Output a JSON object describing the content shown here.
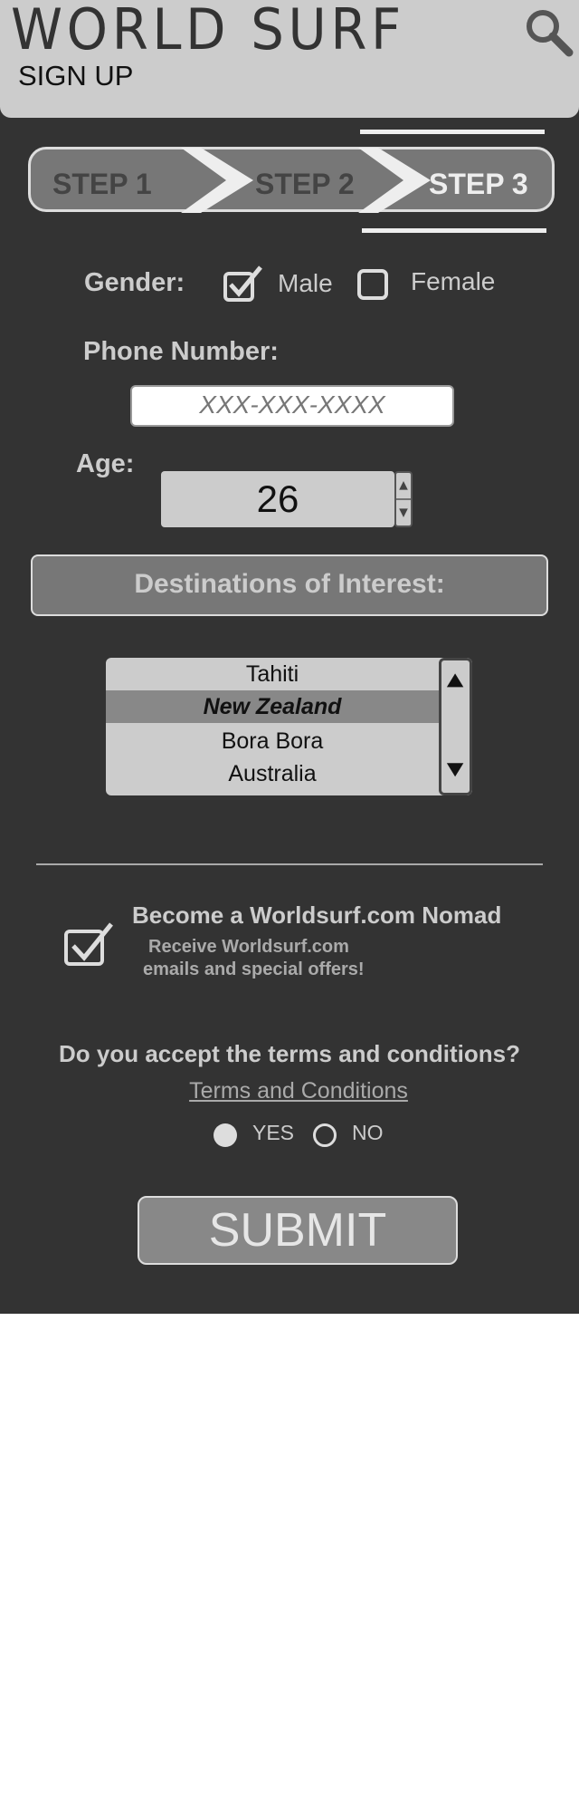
{
  "header": {
    "brand": "WORLD SURF",
    "page_title": "SIGN UP",
    "search_icon": "search-icon"
  },
  "steps": [
    {
      "label": "STEP 1",
      "active": false
    },
    {
      "label": "STEP 2",
      "active": false
    },
    {
      "label": "STEP 3",
      "active": true
    }
  ],
  "gender": {
    "label": "Gender:",
    "options": [
      {
        "label": "Male",
        "checked": true
      },
      {
        "label": "Female",
        "checked": false
      }
    ]
  },
  "phone": {
    "label": "Phone Number:",
    "placeholder": "XXX-XXX-XXXX"
  },
  "age": {
    "label": "Age:",
    "value": "26"
  },
  "destinations": {
    "label": "Destinations of Interest:",
    "items": [
      "Tahiti",
      "New Zealand",
      "Bora Bora",
      "Australia"
    ],
    "selected": "New Zealand"
  },
  "nomad": {
    "checked": true,
    "title": "Become a Worldsurf.com Nomad",
    "subtitle_line1": "Receive Worldsurf.com",
    "subtitle_line2": "emails and special offers!"
  },
  "terms": {
    "question": "Do you accept the terms and conditions?",
    "link": "Terms and Conditions",
    "options": [
      {
        "label": "YES",
        "selected": true
      },
      {
        "label": "NO",
        "selected": false
      }
    ]
  },
  "submit_label": "SUBMIT",
  "colors": {
    "app_background": "#333333",
    "header_background": "#cccccc",
    "accent_gray": "#777777"
  }
}
